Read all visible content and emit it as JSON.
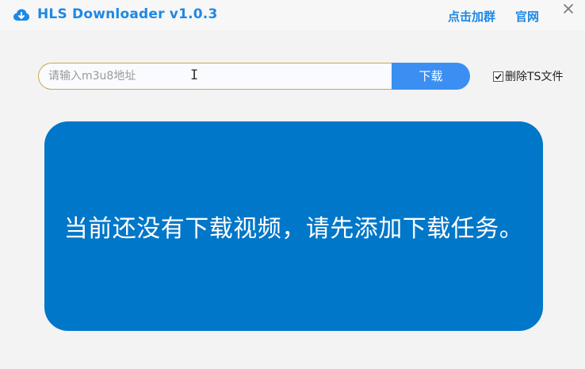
{
  "titlebar": {
    "app_title": "HLS Downloader v1.0.3",
    "link_group": "点击加群",
    "link_site": "官网",
    "close_icon": "close-icon",
    "app_icon": "cloud-download-icon"
  },
  "url_bar": {
    "placeholder": "请输入m3u8地址",
    "value": "",
    "download_label": "下载"
  },
  "options": {
    "delete_ts_label": "删除TS文件",
    "delete_ts_checked": true
  },
  "main": {
    "empty_message": "当前还没有下载视频，请先添加下载任务。"
  },
  "colors": {
    "accent": "#1e88e5",
    "button": "#3b8ff2",
    "panel": "#0077c8",
    "input_border": "#c9a64f"
  }
}
